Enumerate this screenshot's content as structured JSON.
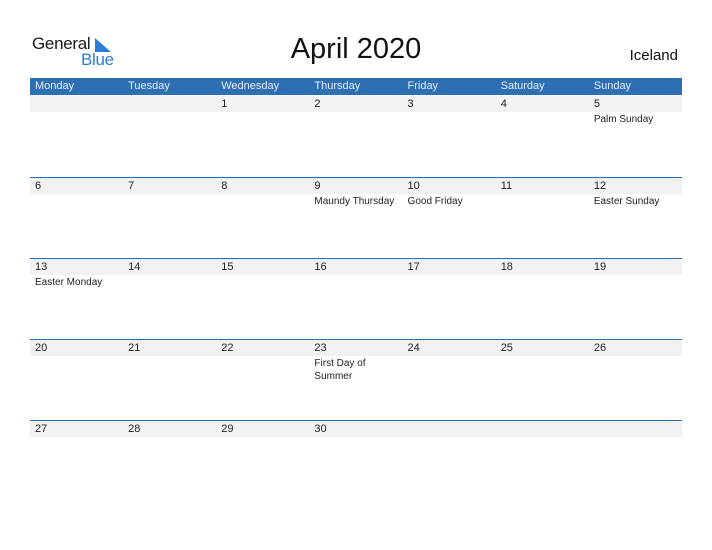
{
  "logo": {
    "line1": "General",
    "line2": "Blue"
  },
  "title": "April 2020",
  "country": "Iceland",
  "colors": {
    "accent": "#2e6fb3",
    "strip": "#f2f2f2",
    "logo_blue": "#2a7fd4"
  },
  "weekdays": [
    "Monday",
    "Tuesday",
    "Wednesday",
    "Thursday",
    "Friday",
    "Saturday",
    "Sunday"
  ],
  "weeks": [
    {
      "days": [
        {
          "num": "",
          "event": ""
        },
        {
          "num": "",
          "event": ""
        },
        {
          "num": "1",
          "event": ""
        },
        {
          "num": "2",
          "event": ""
        },
        {
          "num": "3",
          "event": ""
        },
        {
          "num": "4",
          "event": ""
        },
        {
          "num": "5",
          "event": "Palm Sunday"
        }
      ]
    },
    {
      "days": [
        {
          "num": "6",
          "event": ""
        },
        {
          "num": "7",
          "event": ""
        },
        {
          "num": "8",
          "event": ""
        },
        {
          "num": "9",
          "event": "Maundy Thursday"
        },
        {
          "num": "10",
          "event": "Good Friday"
        },
        {
          "num": "11",
          "event": ""
        },
        {
          "num": "12",
          "event": "Easter Sunday"
        }
      ]
    },
    {
      "days": [
        {
          "num": "13",
          "event": "Easter Monday"
        },
        {
          "num": "14",
          "event": ""
        },
        {
          "num": "15",
          "event": ""
        },
        {
          "num": "16",
          "event": ""
        },
        {
          "num": "17",
          "event": ""
        },
        {
          "num": "18",
          "event": ""
        },
        {
          "num": "19",
          "event": ""
        }
      ]
    },
    {
      "days": [
        {
          "num": "20",
          "event": ""
        },
        {
          "num": "21",
          "event": ""
        },
        {
          "num": "22",
          "event": ""
        },
        {
          "num": "23",
          "event": "First Day of Summer"
        },
        {
          "num": "24",
          "event": ""
        },
        {
          "num": "25",
          "event": ""
        },
        {
          "num": "26",
          "event": ""
        }
      ]
    },
    {
      "days": [
        {
          "num": "27",
          "event": ""
        },
        {
          "num": "28",
          "event": ""
        },
        {
          "num": "29",
          "event": ""
        },
        {
          "num": "30",
          "event": ""
        },
        {
          "num": "",
          "event": ""
        },
        {
          "num": "",
          "event": ""
        },
        {
          "num": "",
          "event": ""
        }
      ]
    }
  ]
}
